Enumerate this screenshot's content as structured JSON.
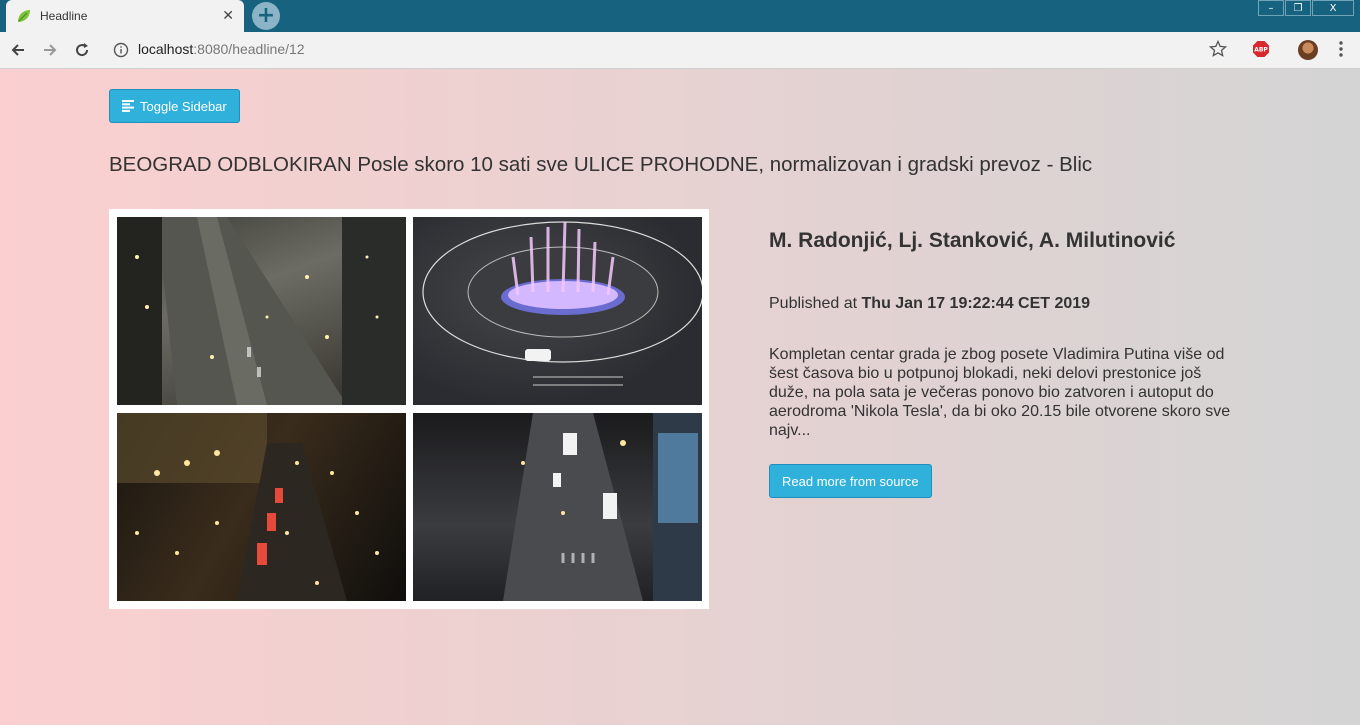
{
  "browser": {
    "tab_title": "Headline",
    "new_tab_symbol": "+",
    "url_host": "localhost",
    "url_path": ":8080/headline/12",
    "window_buttons": [
      "–",
      "❐",
      "X"
    ],
    "icons": [
      "leaf-favicon-icon",
      "back-arrow-icon",
      "forward-arrow-icon",
      "reload-icon",
      "info-icon",
      "star-icon",
      "adblock-icon",
      "avatar",
      "kebab-menu-icon"
    ]
  },
  "page": {
    "toggle_label": "Toggle Sidebar",
    "headline": "BEOGRAD ODBLOKIRAN Posle skoro 10 sati sve ULICE PROHODNE, normalizovan i gradski prevoz - Blic",
    "authors": "M. Radonjić, Lj. Stanković, A. Milutinović",
    "published_prefix": "Published at",
    "published_date": "Thu Jan 17 19:22:44 CET 2019",
    "summary": "Kompletan centar grada je zbog posete Vladimira Putina više od šest časova bio u potpunoj blokadi, neki delovi prestonice još duže, na pola sata je večeras ponovo bio zatvoren i autoput do aerodroma 'Nikola Tesla', da bi oko 20.15 bile otvorene skoro sve najv...",
    "source_button": "Read more from source",
    "accent_color": "#2fb1dc"
  }
}
